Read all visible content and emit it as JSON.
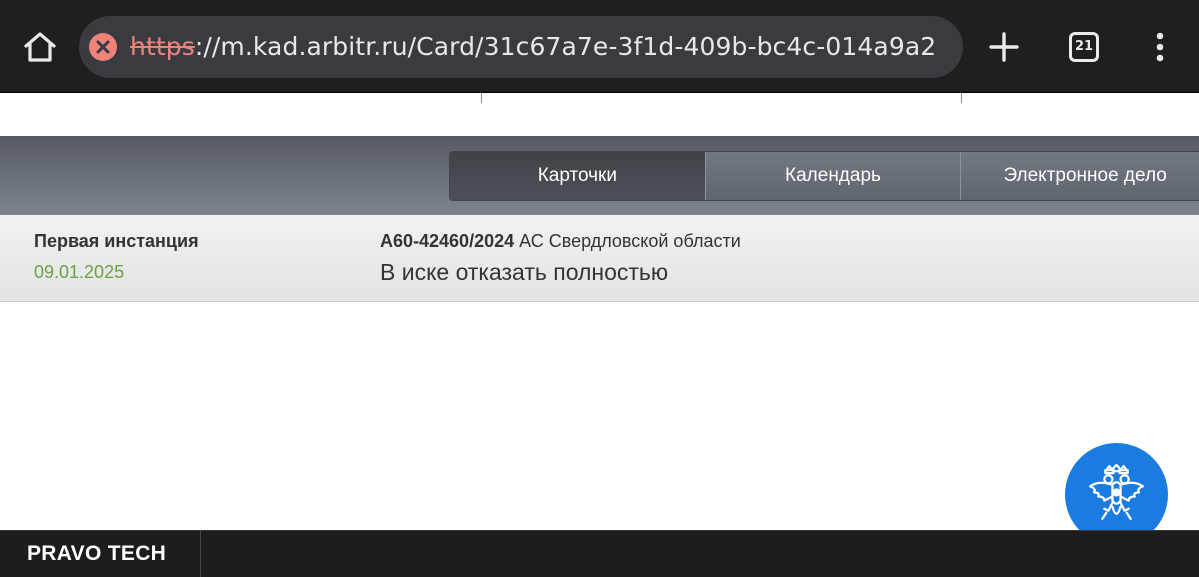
{
  "browser": {
    "url_scheme": "https",
    "url_rest": "://m.kad.arbitr.ru/Card/31c67a7e-3f1d-409b-bc4c-014a9a2",
    "tab_count": "21",
    "colors": {
      "chrome_bg": "#1f1f1f",
      "url_box": "#3a3b40",
      "insecure": "#f0827a"
    }
  },
  "nav": {
    "tabs": [
      {
        "label": "Карточки",
        "active": true
      },
      {
        "label": "Календарь",
        "active": false
      },
      {
        "label": "Электронное дело",
        "active": false
      }
    ]
  },
  "case": {
    "instance_label": "Первая инстанция",
    "date": "09.01.2025",
    "number": "А60-42460/2024",
    "court": " АС Свердловской области",
    "result": "В иске отказать полностью"
  },
  "footer": {
    "brand": "PRAVO TECH"
  },
  "icons": {
    "home": "home-icon",
    "insecure": "insecure-warning-icon",
    "new_tab": "plus-icon",
    "tabs": "tab-switcher-icon",
    "menu": "more-vertical-icon",
    "fab": "russian-coat-of-arms-icon"
  },
  "colors": {
    "date": "#6ea043",
    "fab": "#1a7be0",
    "footer": "#1d1d1f"
  }
}
